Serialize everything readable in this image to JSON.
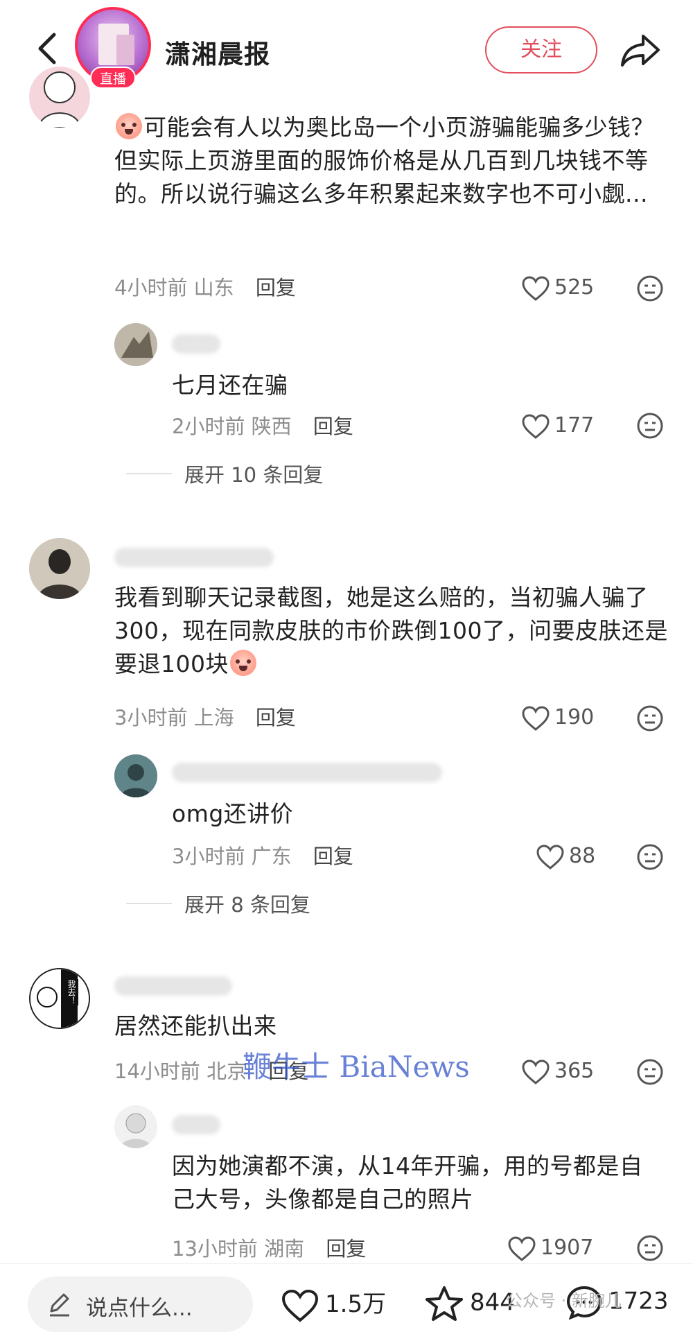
{
  "header": {
    "account_name": "潇湘晨报",
    "live_badge": "直播",
    "follow_label": "关注"
  },
  "comments": [
    {
      "text": "可能会有人以为奥比岛一个小页游骗能骗多少钱？但实际上页游里面的服饰价格是从几百到几块钱不等的。所以说行骗这么多年积累起来数字也不可小觑...",
      "time": "4小时前",
      "location": "山东",
      "reply_label": "回复",
      "likes": "525",
      "replies": [
        {
          "text": "七月还在骗",
          "time": "2小时前",
          "location": "陕西",
          "reply_label": "回复",
          "likes": "177"
        }
      ],
      "expand_label": "展开 10 条回复"
    },
    {
      "text": "我看到聊天记录截图，她是这么赔的，当初骗人骗了300，现在同款皮肤的市价跌倒100了，问要皮肤还是要退100块",
      "time": "3小时前",
      "location": "上海",
      "reply_label": "回复",
      "likes": "190",
      "replies": [
        {
          "text": "omg还讲价",
          "time": "3小时前",
          "location": "广东",
          "reply_label": "回复",
          "likes": "88"
        }
      ],
      "expand_label": "展开 8 条回复"
    },
    {
      "text": "居然还能扒出来",
      "time": "14小时前",
      "location": "北京",
      "reply_label": "回复",
      "likes": "365",
      "avatar_text": "我去！",
      "replies": [
        {
          "text": "因为她演都不演，从14年开骗，用的号都是自己大号，头像都是自己的照片",
          "time": "13小时前",
          "location": "湖南",
          "reply_label": "回复",
          "likes": "1907"
        }
      ]
    }
  ],
  "watermark": "鞭牛士 BiaNews",
  "bottom_bar": {
    "input_placeholder": "说点什么...",
    "likes": "1.5万",
    "favorites": "844",
    "comments": "1723",
    "wechat_watermark": "公众号 · 新腕儿"
  },
  "colors": {
    "accent_red": "#e24e5b",
    "live_pink": "#ff2c55",
    "meta_gray": "#8d8d8d",
    "watermark_blue": "#3658c9"
  }
}
